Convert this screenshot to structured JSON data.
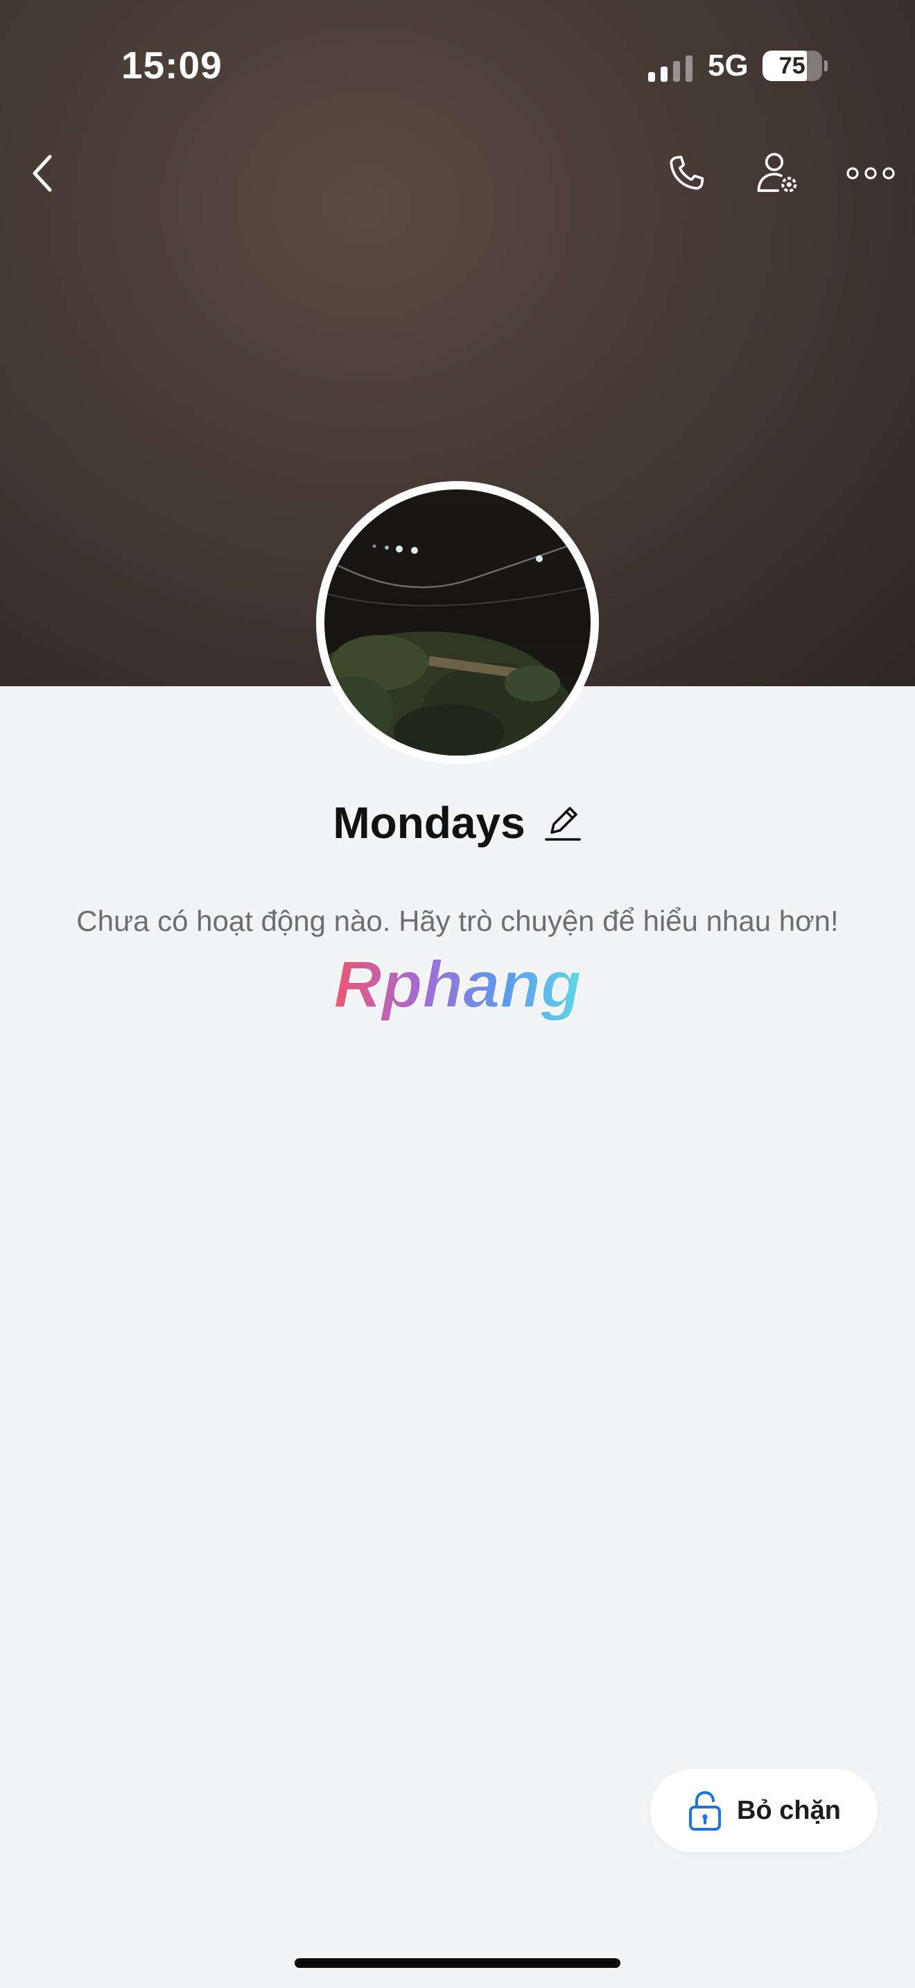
{
  "status_bar": {
    "time": "15:09",
    "network": "5G",
    "battery_percent": "75"
  },
  "header": {
    "back_icon": "chevron-left-icon",
    "call_icon": "phone-icon",
    "settings_icon": "user-settings-icon",
    "more_icon": "more-horizontal-icon"
  },
  "profile": {
    "name": "Mondays",
    "edit_icon": "pencil-icon",
    "empty_message": "Chưa có hoạt động nào. Hãy trò chuyện để hiểu nhau hơn!"
  },
  "watermark": {
    "text": "Rphang"
  },
  "unblock_button": {
    "label": "Bỏ chặn",
    "icon": "unlock-icon"
  },
  "colors": {
    "background": "#f3f4f6",
    "accent_blue": "#1a73e8",
    "text_primary": "#111111",
    "text_secondary": "#6e6e6e"
  }
}
